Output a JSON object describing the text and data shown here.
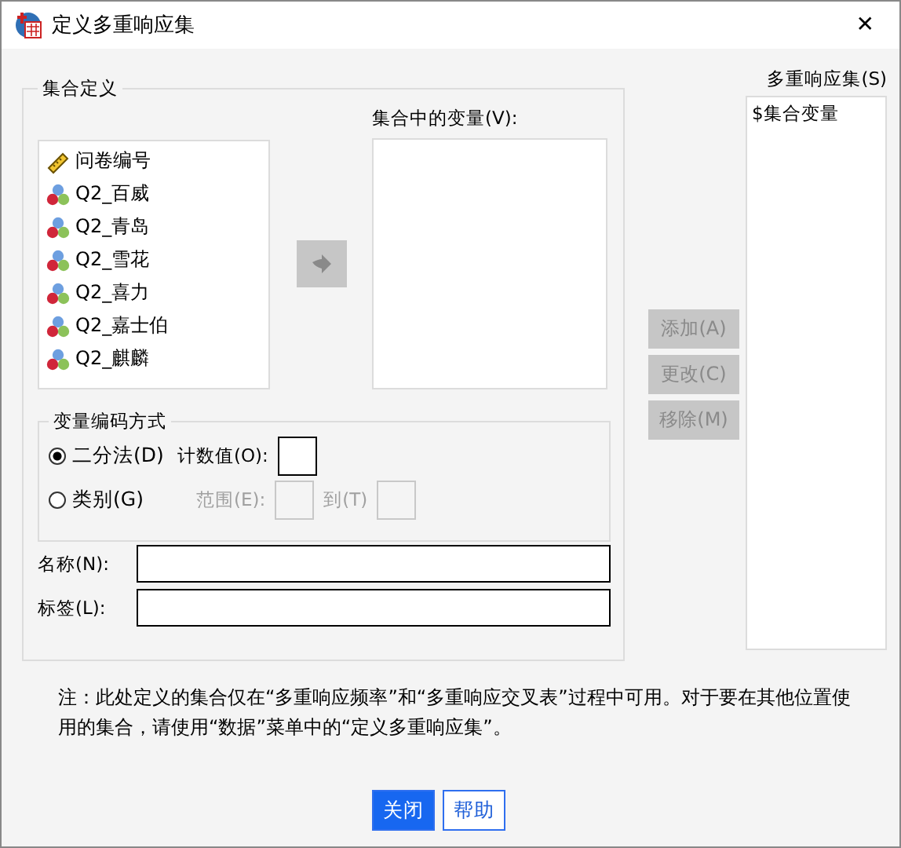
{
  "window": {
    "title": "定义多重响应集",
    "close_glyph": "✕"
  },
  "set_definition": {
    "title": "集合定义",
    "variables": [
      {
        "label": "问卷编号",
        "kind": "scale"
      },
      {
        "label": "Q2_百威",
        "kind": "nominal"
      },
      {
        "label": "Q2_青岛",
        "kind": "nominal"
      },
      {
        "label": "Q2_雪花",
        "kind": "nominal"
      },
      {
        "label": "Q2_喜力",
        "kind": "nominal"
      },
      {
        "label": "Q2_嘉士伯",
        "kind": "nominal"
      },
      {
        "label": "Q2_麒麟",
        "kind": "nominal"
      }
    ],
    "move_button": {
      "disabled": true
    },
    "variables_in_set": {
      "label": "集合中的变量(V):"
    },
    "coding": {
      "title": "变量编码方式",
      "options": [
        {
          "label": "二分法(D)",
          "selected": true
        },
        {
          "label": "类别(G)",
          "selected": false
        }
      ],
      "counted_value": {
        "label": "计数值(O):"
      },
      "range": {
        "label": "范围(E):",
        "to_label": "到(T)",
        "disabled": true
      }
    },
    "name_field": {
      "label": "名称(N):"
    },
    "label_field": {
      "label": "标签(L):"
    }
  },
  "set_buttons": [
    {
      "label": "添加(A)",
      "disabled": true
    },
    {
      "label": "更改(C)",
      "disabled": true
    },
    {
      "label": "移除(M)",
      "disabled": true
    }
  ],
  "multiple_response_sets": {
    "label": "多重响应集(S)",
    "items": [
      "$集合变量"
    ]
  },
  "note": "注：此处定义的集合仅在“多重响应频率”和“多重响应交叉表”过程中可用。对于要在其他位置使用的集合，请使用“数据”菜单中的“定义多重响应集”。",
  "buttons": [
    {
      "label": "关闭",
      "primary": true
    },
    {
      "label": "帮助",
      "primary": false
    }
  ]
}
